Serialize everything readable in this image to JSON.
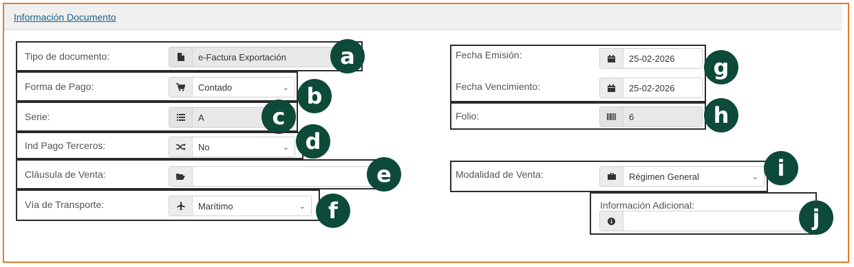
{
  "panel": {
    "title": "Información Documento",
    "border_color": "#e8782d",
    "badge_color": "#0d4a3a"
  },
  "left": {
    "tipo_documento": {
      "label": "Tipo de documento:",
      "value": "e-Factura Exportación",
      "icon": "file-icon",
      "badge": "a"
    },
    "forma_pago": {
      "label": "Forma de Pago:",
      "value": "Contado",
      "icon": "cart-icon",
      "badge": "b"
    },
    "serie": {
      "label": "Serie:",
      "value": "A",
      "icon": "list-icon",
      "badge": "c"
    },
    "ind_pago_terceros": {
      "label": "Ind Pago Terceros:",
      "value": "No",
      "icon": "shuffle-icon",
      "badge": "d"
    },
    "clausula_venta": {
      "label": "Cláusula de Venta:",
      "value": "",
      "icon": "folder-open-icon",
      "badge": "e"
    },
    "via_transporte": {
      "label": "Vía de Transporte:",
      "value": "Marítimo",
      "icon": "plane-icon",
      "badge": "f"
    }
  },
  "right": {
    "fecha_emision": {
      "label": "Fecha Emisión:",
      "value": "25-02-2026",
      "icon": "calendar-icon"
    },
    "fecha_vencimiento": {
      "label": "Fecha Vencimiento:",
      "value": "25-02-2026",
      "icon": "calendar-icon"
    },
    "fechas_badge": "g",
    "folio": {
      "label": "Folio:",
      "value": "6",
      "icon": "barcode-icon",
      "badge": "h"
    },
    "modalidad_venta": {
      "label": "Modalidad de Venta:",
      "value": "Régimen General",
      "icon": "briefcase-icon",
      "badge": "i"
    },
    "informacion_adicional": {
      "label": "Información Adicional:",
      "value": "",
      "icon": "info-icon",
      "badge": "j"
    }
  }
}
